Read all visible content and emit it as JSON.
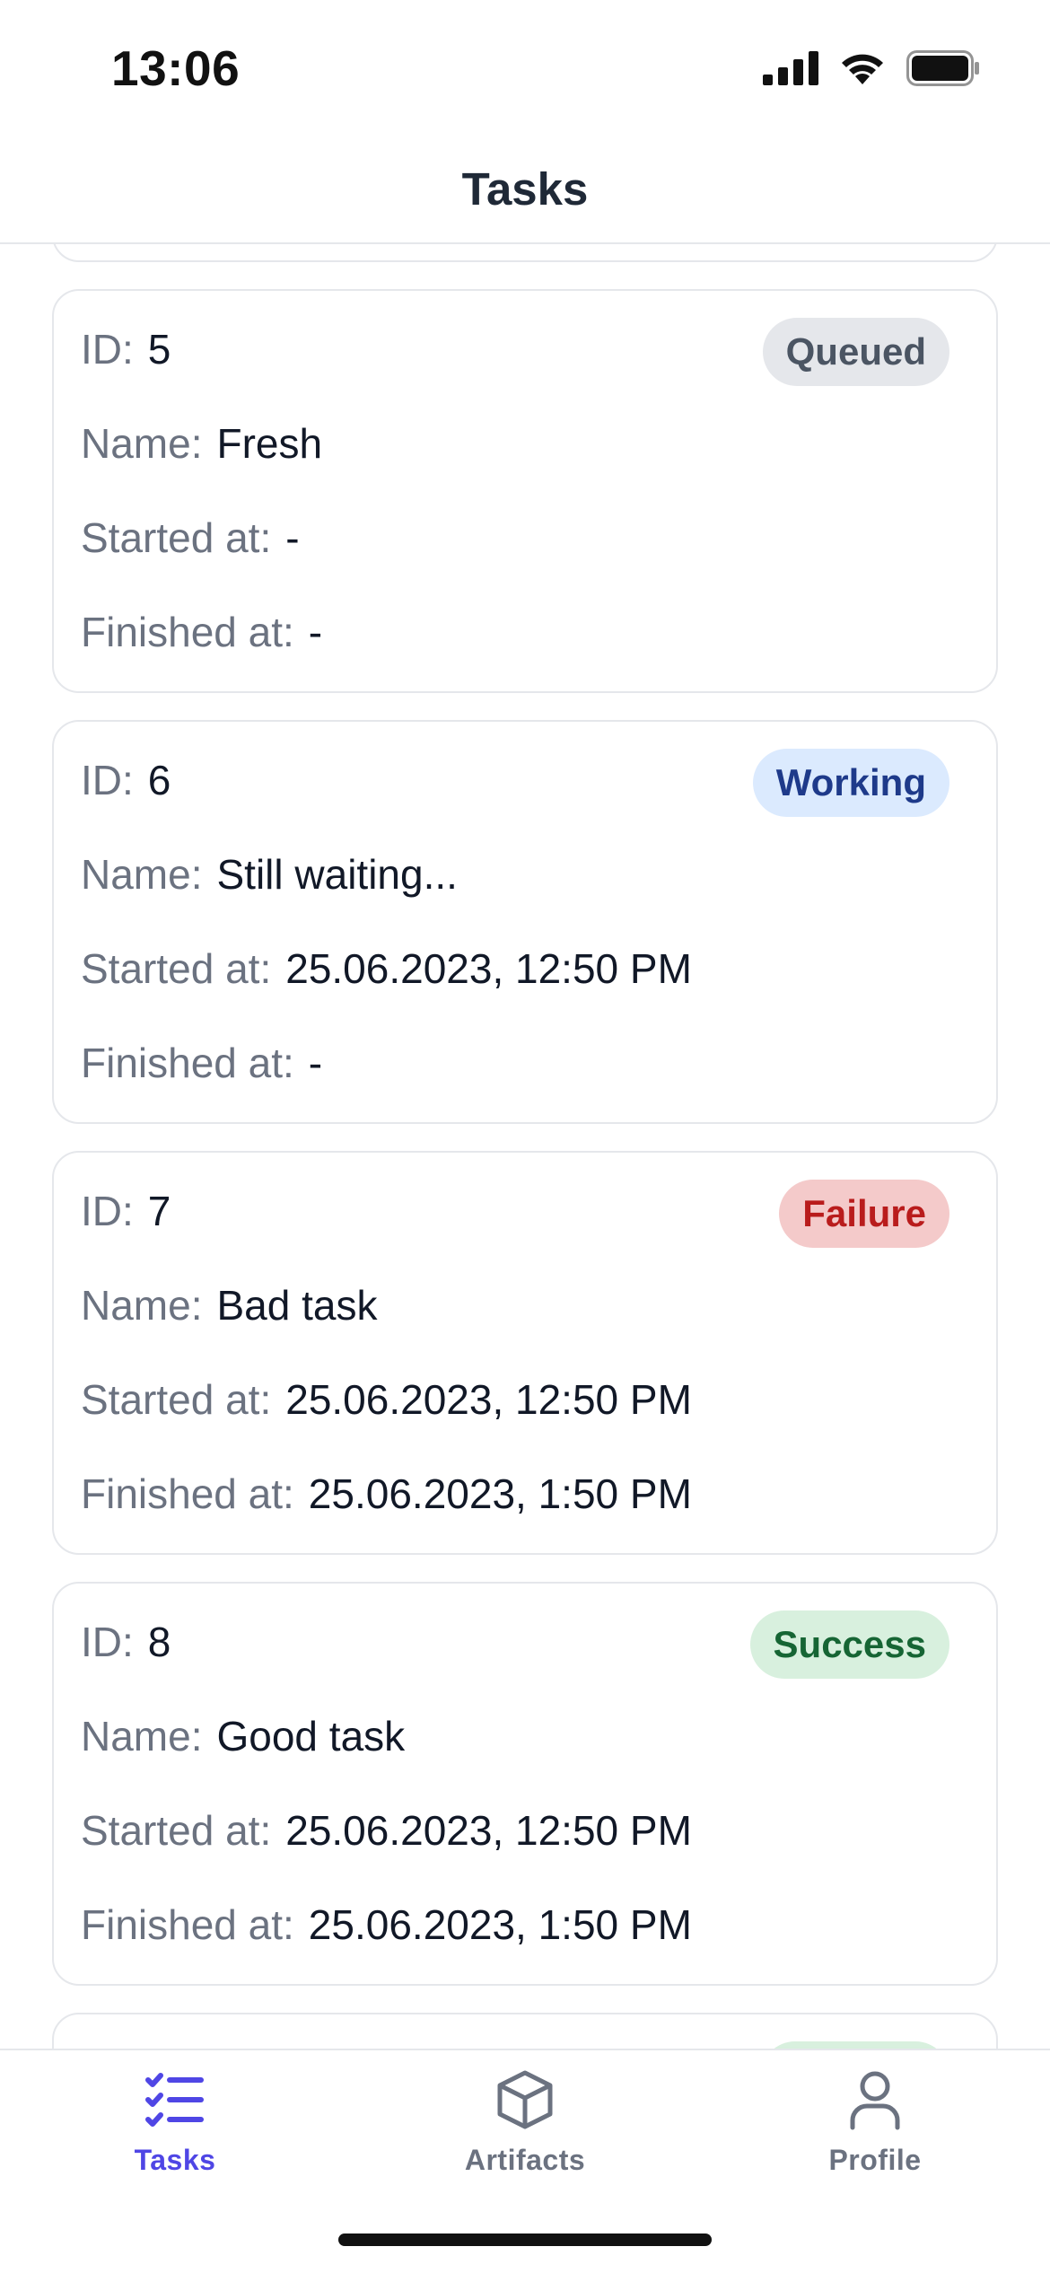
{
  "status_bar": {
    "time": "13:06"
  },
  "header": {
    "title": "Tasks"
  },
  "labels": {
    "id": "ID:",
    "name": "Name:",
    "started": "Started at:",
    "finished": "Finished at:"
  },
  "tasks": [
    {
      "id": "5",
      "name": "Fresh",
      "started": "-",
      "finished": "-",
      "status": "Queued"
    },
    {
      "id": "6",
      "name": "Still waiting...",
      "started": "25.06.2023, 12:50 PM",
      "finished": "-",
      "status": "Working"
    },
    {
      "id": "7",
      "name": "Bad task",
      "started": "25.06.2023, 12:50 PM",
      "finished": "25.06.2023, 1:50 PM",
      "status": "Failure"
    },
    {
      "id": "8",
      "name": "Good task",
      "started": "25.06.2023, 12:50 PM",
      "finished": "25.06.2023, 1:50 PM",
      "status": "Success"
    }
  ],
  "tabbar": {
    "items": [
      {
        "label": "Tasks",
        "icon": "tasks-list-icon",
        "active": true
      },
      {
        "label": "Artifacts",
        "icon": "cube-icon",
        "active": false
      },
      {
        "label": "Profile",
        "icon": "person-icon",
        "active": false
      }
    ]
  },
  "colors": {
    "accent": "#4f46e5",
    "border": "#e5e7eb"
  }
}
